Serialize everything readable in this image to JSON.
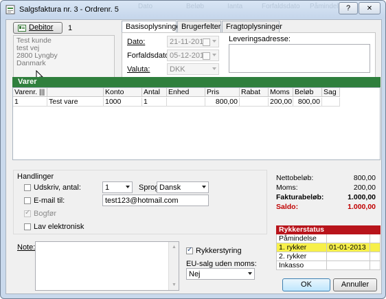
{
  "window": {
    "title": "Salgsfaktura nr. 3 - Ordrenr. 5",
    "bg_texts": [
      "Dato",
      "Beløb",
      "Ianta",
      "Forfaldsdato",
      "Påmindelse"
    ],
    "help_label": "?",
    "close_label": "✕"
  },
  "debitor": {
    "button_label": "Debitor",
    "number": "1",
    "address_lines": [
      "Test kunde",
      "test vej",
      "2800 Lyngby",
      "Danmark"
    ]
  },
  "tabs": [
    {
      "label": "Basisoplysninger",
      "active": true
    },
    {
      "label": "Brugerfelter",
      "active": false
    },
    {
      "label": "Fragtoplysninger",
      "active": false
    }
  ],
  "basis": {
    "dato_label": "Dato:",
    "dato_value": "21-11-2013",
    "forfald_label": "Forfaldsdato:",
    "forfald_value": "05-12-2013",
    "valuta_label": "Valuta:",
    "valuta_value": "DKK",
    "levering_label": "Leveringsadresse:"
  },
  "varer": {
    "section_title": "Varer",
    "columns": [
      "Varenr.",
      "",
      "Konto",
      "Antal",
      "Enhed",
      "Pris",
      "Rabat",
      "Moms",
      "Beløb",
      "Sag"
    ],
    "rows": [
      [
        "1",
        "Test vare",
        "1000",
        "1",
        "",
        "800,00",
        "",
        "200,00",
        "800,00",
        ""
      ]
    ]
  },
  "handlinger": {
    "title": "Handlinger",
    "udskriv_label": "Udskriv, antal:",
    "udskriv_antal": "1",
    "sprog_label": "Sprog:",
    "sprog_value": "Dansk",
    "email_label": "E-mail til:",
    "email_value": "test123@hotmail.com",
    "bogfor_label": "Bogfør",
    "bogfor_checked": true,
    "lav_elektronisk_label": "Lav elektronisk"
  },
  "totals": {
    "netto_label": "Nettobeløb:",
    "netto_value": "800,00",
    "moms_label": "Moms:",
    "moms_value": "200,00",
    "faktura_label": "Fakturabeløb:",
    "faktura_value": "1.000,00",
    "saldo_label": "Saldo:",
    "saldo_value": "1.000,00",
    "saldo_color": "#c00000"
  },
  "rykker": {
    "title": "Rykkerstatus",
    "title_color": "#b8141b",
    "rows": [
      {
        "label": "Påmindelse",
        "date": ""
      },
      {
        "label": "1. rykker",
        "date": "01-01-2013",
        "highlight": true
      },
      {
        "label": "2. rykker",
        "date": ""
      },
      {
        "label": "Inkasso",
        "date": ""
      }
    ],
    "highlight_color": "#f7f04a"
  },
  "note": {
    "label": "Note:",
    "rykkerstyring_label": "Rykkerstyring",
    "rykkerstyring_checked": true,
    "eu_label": "EU-salg uden moms:",
    "eu_value": "Nej"
  },
  "buttons": {
    "ok_label": "OK",
    "cancel_label": "Annuller"
  },
  "colors": {
    "varer_bar": "#2f7f3d",
    "window_frame": "#c9d9ec"
  }
}
